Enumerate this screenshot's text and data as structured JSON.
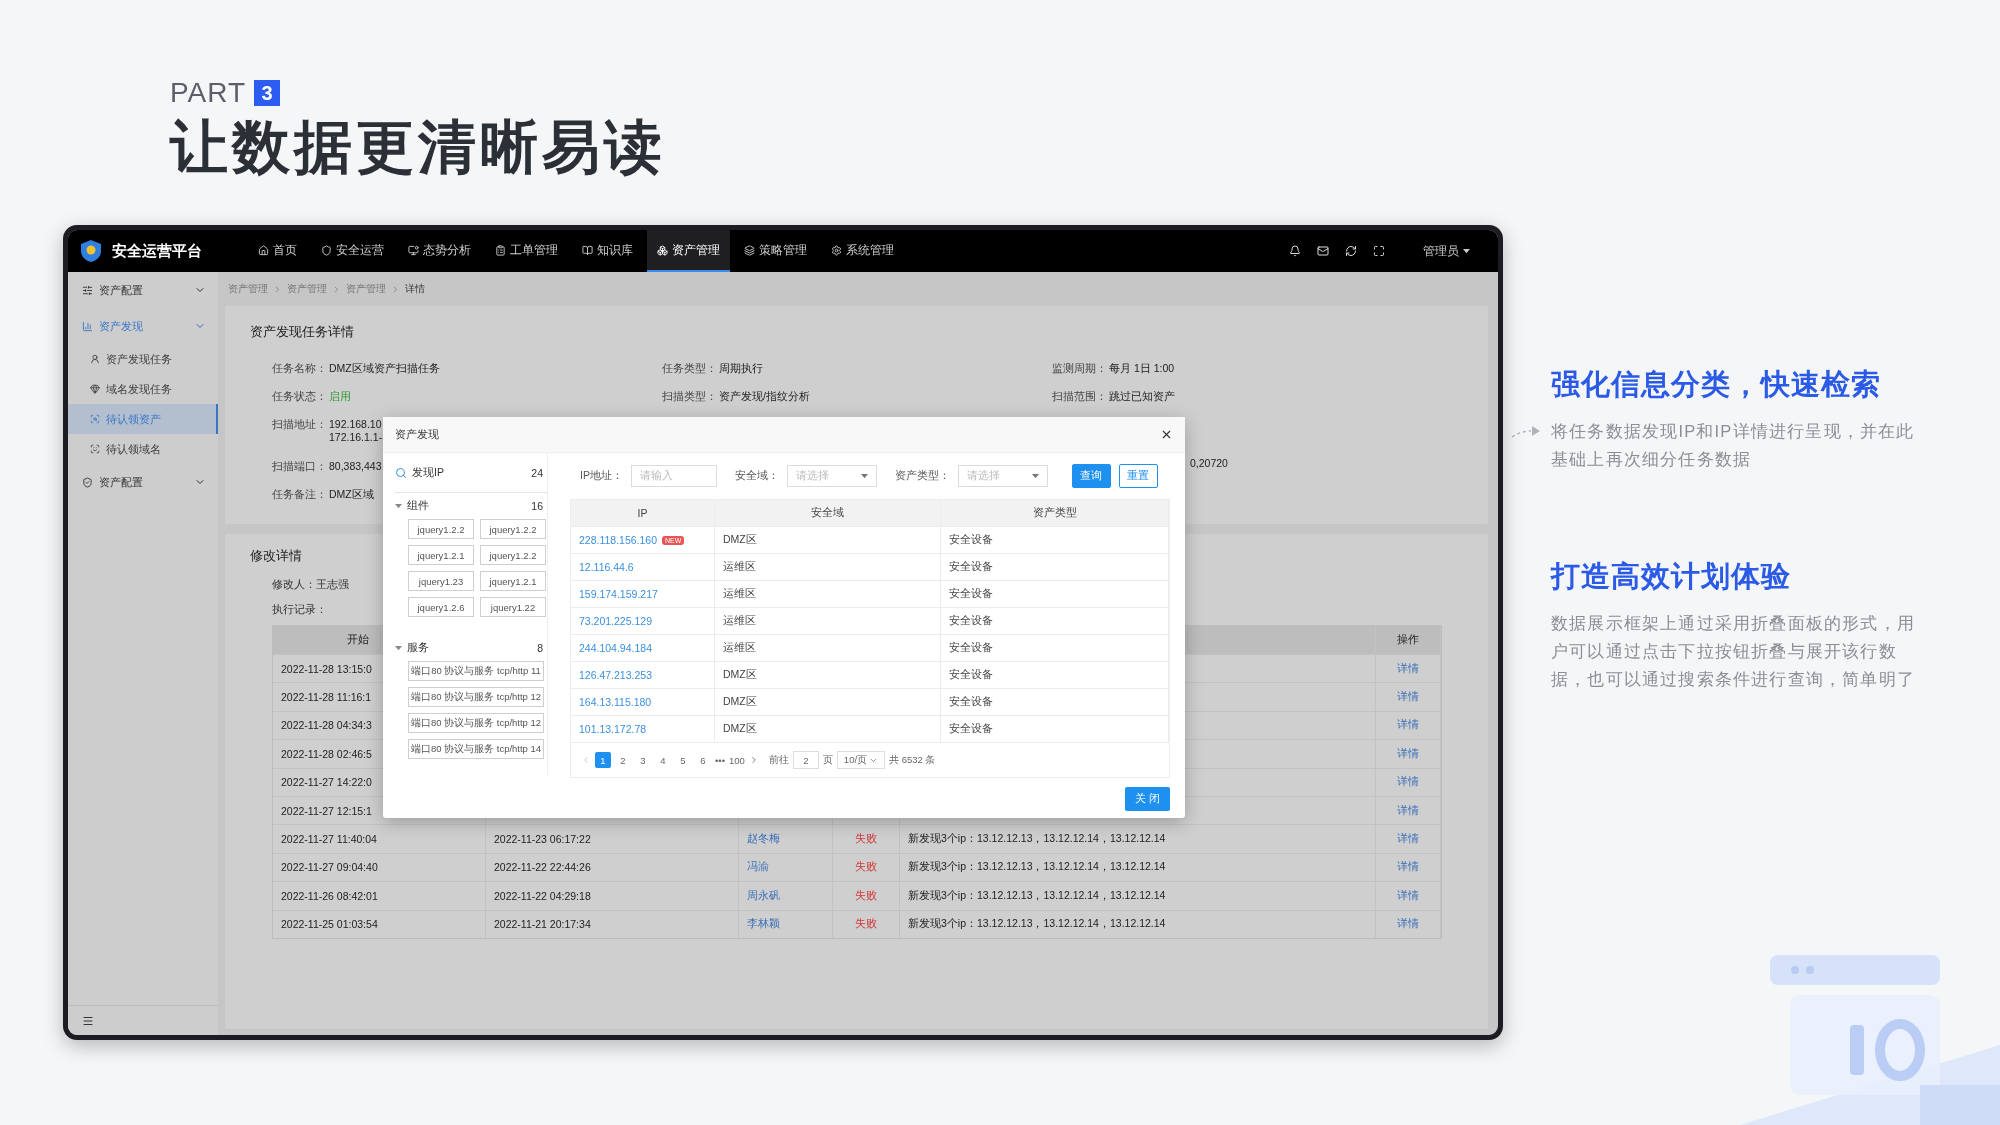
{
  "slide": {
    "part_label": "PART",
    "part_number": "3",
    "title": "让数据更清晰易读"
  },
  "app": {
    "brand": "安全运营平台",
    "nav": [
      {
        "label": "首页",
        "selected": false
      },
      {
        "label": "安全运营",
        "selected": false
      },
      {
        "label": "态势分析",
        "selected": false
      },
      {
        "label": "工单管理",
        "selected": false
      },
      {
        "label": "知识库",
        "selected": false
      },
      {
        "label": "资产管理",
        "selected": true
      },
      {
        "label": "策略管理",
        "selected": false
      },
      {
        "label": "系统管理",
        "selected": false
      }
    ],
    "user": "管理员",
    "sidebar": [
      {
        "label": "资产配置",
        "expanded": false
      },
      {
        "label": "资产发现",
        "expanded": true,
        "children": [
          {
            "label": "资产发现任务",
            "selected": false
          },
          {
            "label": "域名发现任务",
            "selected": false
          },
          {
            "label": "待认领资产",
            "selected": true
          },
          {
            "label": "待认领域名",
            "selected": false
          }
        ]
      },
      {
        "label": "资产配置",
        "expanded": false
      }
    ],
    "breadcrumb": [
      "资产管理",
      "资产管理",
      "资产管理",
      "详情"
    ],
    "task_card": {
      "title": "资产发现任务详情",
      "columns": [
        [
          {
            "label": "任务名称：",
            "value": [
              "DMZ区域资产扫描任务"
            ],
            "highlighted": false
          },
          {
            "label": "任务状态：",
            "value": [
              "启用"
            ],
            "highlighted": true
          },
          {
            "label": "扫描地址：",
            "value": [
              "192.168.10",
              "172.16.1.1-"
            ],
            "highlighted": false
          },
          {
            "label": "扫描端口：",
            "value": [
              "80,383,443"
            ],
            "highlighted": false
          },
          {
            "label": "任务备注：",
            "value": [
              "DMZ区域"
            ],
            "highlighted": false
          }
        ],
        [
          {
            "label": "任务类型：",
            "value": [
              "周期执行"
            ],
            "highlighted": false
          },
          {
            "label": "扫描类型：",
            "value": [
              "资产发现/指纹分析"
            ],
            "highlighted": false
          }
        ],
        [
          {
            "label": "监测周期：",
            "value": [
              "每月 1日 1:00"
            ],
            "highlighted": false
          },
          {
            "label": "扫描范围：",
            "value": [
              "跳过已知资产"
            ],
            "highlighted": false
          }
        ]
      ],
      "port_tail": "0,20720"
    },
    "change_card": {
      "title": "修改详情",
      "editor_label": "修改人：",
      "editor": "王志强",
      "log_label": "执行记录：",
      "table": {
        "start_header": "开始",
        "action_header": "操作",
        "rows": [
          {
            "start": "2022-11-28 13:15:0",
            "action": "详情"
          },
          {
            "start": "2022-11-28 11:16:1",
            "action": "详情"
          },
          {
            "start": "2022-11-28 04:34:3",
            "action": "详情"
          },
          {
            "start": "2022-11-28 02:46:5",
            "action": "详情"
          },
          {
            "start": "2022-11-27 14:22:0",
            "action": "详情"
          },
          {
            "start": "2022-11-27 12:15:1",
            "action": "详情"
          },
          {
            "start": "2022-11-27 11:40:04",
            "end": "2022-11-23 06:17:22",
            "operator": "赵冬梅",
            "status": "失败",
            "failed": true,
            "note": "新发现3个ip：13.12.12.13，13.12.12.14，13.12.12.14",
            "action": "详情"
          },
          {
            "start": "2022-11-27 09:04:40",
            "end": "2022-11-22 22:44:26",
            "operator": "冯渝",
            "status": "失败",
            "failed": true,
            "note": "新发现3个ip：13.12.12.13，13.12.12.14，13.12.12.14",
            "action": "详情"
          },
          {
            "start": "2022-11-26 08:42:01",
            "end": "2022-11-22 04:29:18",
            "operator": "周永矾",
            "status": "失败",
            "failed": true,
            "note": "新发现3个ip：13.12.12.13，13.12.12.14，13.12.12.14",
            "action": "详情"
          },
          {
            "start": "2022-11-25 01:03:54",
            "end": "2022-11-21 20:17:34",
            "operator": "李林颖",
            "status": "失败",
            "failed": true,
            "note": "新发现3个ip：13.12.12.13，13.12.12.14，13.12.12.14",
            "action": "详情"
          }
        ]
      }
    },
    "modal": {
      "title": "资产发现",
      "found_ip": {
        "label": "发现IP",
        "count": "24"
      },
      "groups": [
        {
          "label": "组件",
          "count": "16",
          "expanded": true,
          "kind": "pairs",
          "tags": [
            "jquery1.2.2",
            "jquery1.2.2",
            "jquery1.2.1",
            "jquery1.2.2",
            "jquery1.23",
            "jquery1.2.1",
            "jquery1.2.6",
            "jquery1.22"
          ]
        },
        {
          "label": "服务",
          "count": "8",
          "expanded": true,
          "kind": "wide",
          "tags": [
            "端口80 协议与服务 tcp/http 11",
            "端口80 协议与服务 tcp/http 12",
            "端口80 协议与服务 tcp/http 12",
            "端口80 协议与服务 tcp/http 14"
          ]
        }
      ],
      "filters": [
        {
          "kind": "input",
          "label": "IP地址：",
          "placeholder": "请输入"
        },
        {
          "kind": "select",
          "label": "安全域：",
          "placeholder": "请选择"
        },
        {
          "kind": "select",
          "label": "资产类型：",
          "placeholder": "请选择"
        }
      ],
      "search_button": "查询",
      "reset_button": "重置",
      "table": {
        "columns": [
          "IP",
          "安全域",
          "资产类型"
        ],
        "rows": [
          {
            "ip": "228.118.156.160",
            "badge": "NEW",
            "zone": "DMZ区",
            "type": "安全设备"
          },
          {
            "ip": "12.116.44.6",
            "zone": "运维区",
            "type": "安全设备"
          },
          {
            "ip": "159.174.159.217",
            "zone": "运维区",
            "type": "安全设备"
          },
          {
            "ip": "73.201.225.129",
            "zone": "运维区",
            "type": "安全设备"
          },
          {
            "ip": "244.104.94.184",
            "zone": "运维区",
            "type": "安全设备"
          },
          {
            "ip": "126.47.213.253",
            "zone": "DMZ区",
            "type": "安全设备"
          },
          {
            "ip": "164.13.115.180",
            "zone": "DMZ区",
            "type": "安全设备"
          },
          {
            "ip": "101.13.172.78",
            "zone": "DMZ区",
            "type": "安全设备"
          }
        ]
      },
      "pagination": {
        "pages": [
          {
            "label": "1",
            "selected": true
          },
          {
            "label": "2",
            "selected": false
          },
          {
            "label": "3",
            "selected": false
          },
          {
            "label": "4",
            "selected": false
          },
          {
            "label": "5",
            "selected": false
          },
          {
            "label": "6",
            "selected": false
          }
        ],
        "ellipsis": "•••",
        "last": "100",
        "goto_label": "前往",
        "goto_value": "2",
        "page_unit": "页",
        "page_size": "10/页",
        "total": "共 6532 条"
      },
      "close_button": "关 闭"
    }
  },
  "features": [
    {
      "heading": "强化信息分类，快速检索",
      "text": "将任务数据发现IP和IP详情进行呈现，并在此基础上再次细分任务数据"
    },
    {
      "heading": "打造高效计划体验",
      "text": "数据展示框架上通过采用折叠面板的形式，用户可以通过点击下拉按钮折叠与展开该行数据，也可以通过搜索条件进行查询，简单明了"
    }
  ]
}
